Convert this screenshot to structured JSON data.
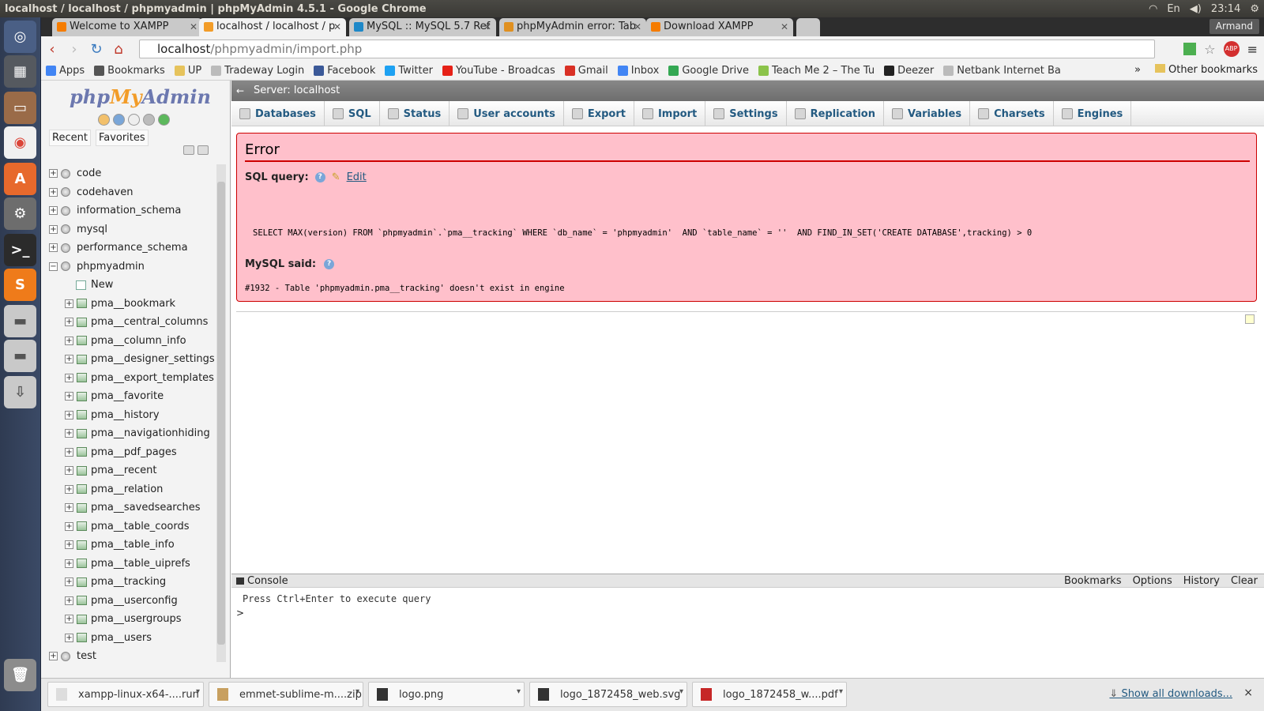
{
  "window": {
    "title": "localhost / localhost / phpmyadmin | phpMyAdmin 4.5.1 - Google Chrome",
    "time": "23:14",
    "keyboard": "En"
  },
  "tabs": [
    {
      "label": "Welcome to XAMPP",
      "color": "#f57c00"
    },
    {
      "label": "localhost / localhost / p",
      "color": "#f29c28",
      "active": true
    },
    {
      "label": "MySQL :: MySQL 5.7 Ref",
      "color": "#1e88c8"
    },
    {
      "label": "phpMyAdmin error: Tab",
      "color": "#e09020"
    },
    {
      "label": "Download XAMPP",
      "color": "#f57c00"
    }
  ],
  "profile": "Armand",
  "url": {
    "host": "localhost",
    "path": "/phpmyadmin/import.php"
  },
  "bookmarks": [
    {
      "label": "Apps",
      "color": "#4285f4"
    },
    {
      "label": "Bookmarks",
      "color": "#555"
    },
    {
      "label": "UP",
      "color": "#e6c35c"
    },
    {
      "label": "Tradeway Login",
      "color": "#bbb"
    },
    {
      "label": "Facebook",
      "color": "#3b5998"
    },
    {
      "label": "Twitter",
      "color": "#1da1f2"
    },
    {
      "label": "YouTube - Broadcas",
      "color": "#e62117"
    },
    {
      "label": "Gmail",
      "color": "#d93025"
    },
    {
      "label": "Inbox",
      "color": "#4285f4"
    },
    {
      "label": "Google Drive",
      "color": "#34a853"
    },
    {
      "label": "Teach Me 2 – The Tu",
      "color": "#8bc34a"
    },
    {
      "label": "Deezer",
      "color": "#222"
    },
    {
      "label": "Netbank Internet Ba",
      "color": "#bbb"
    }
  ],
  "bookmarks_more": "»",
  "other_bookmarks": "Other bookmarks",
  "pma": {
    "logo_php": "php",
    "logo_my": "My",
    "logo_admin": "Admin",
    "recent": "Recent",
    "favorites": "Favorites",
    "server_label": "Server: localhost",
    "menu": [
      "Databases",
      "SQL",
      "Status",
      "User accounts",
      "Export",
      "Import",
      "Settings",
      "Replication",
      "Variables",
      "Charsets",
      "Engines"
    ],
    "databases": [
      "code",
      "codehaven",
      "information_schema",
      "mysql",
      "performance_schema",
      "phpmyadmin"
    ],
    "new_label": "New",
    "tables": [
      "pma__bookmark",
      "pma__central_columns",
      "pma__column_info",
      "pma__designer_settings",
      "pma__export_templates",
      "pma__favorite",
      "pma__history",
      "pma__navigationhiding",
      "pma__pdf_pages",
      "pma__recent",
      "pma__relation",
      "pma__savedsearches",
      "pma__table_coords",
      "pma__table_info",
      "pma__table_uiprefs",
      "pma__tracking",
      "pma__userconfig",
      "pma__usergroups",
      "pma__users"
    ],
    "last_db": "test",
    "error": {
      "title": "Error",
      "sql_query_label": "SQL query:",
      "edit": "Edit",
      "query": "SELECT MAX(version) FROM `phpmyadmin`.`pma__tracking` WHERE `db_name` = 'phpmyadmin'  AND `table_name` = ''  AND FIND_IN_SET('CREATE DATABASE',tracking) > 0",
      "mysql_said": "MySQL said:",
      "message": "#1932 - Table 'phpmyadmin.pma__tracking' doesn't exist in engine"
    },
    "console": {
      "label": "Console",
      "actions": [
        "Bookmarks",
        "Options",
        "History",
        "Clear"
      ],
      "hint": "Press Ctrl+Enter to execute query",
      "prompt": ">"
    }
  },
  "downloads": [
    {
      "name": "xampp-linux-x64-....run",
      "color": "#ddd"
    },
    {
      "name": "emmet-sublime-m....zip",
      "color": "#c8a060"
    },
    {
      "name": "logo.png",
      "color": "#333"
    },
    {
      "name": "logo_1872458_web.svg",
      "color": "#333"
    },
    {
      "name": "logo_1872458_w....pdf",
      "color": "#c62828"
    }
  ],
  "show_all_downloads": "Show all downloads...",
  "close_shelf": "×"
}
